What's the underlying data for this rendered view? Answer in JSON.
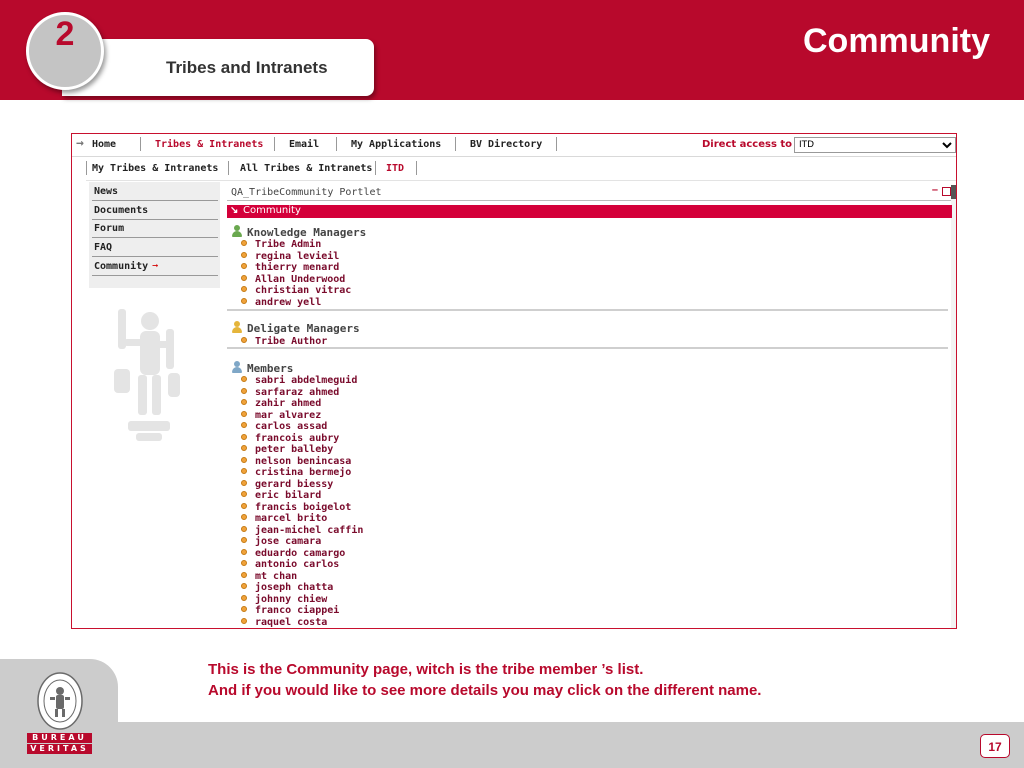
{
  "slide": {
    "title": "Community",
    "section_number": "2",
    "section_label": "Tribes and Intranets",
    "caption_line1": "This is the Community page, witch is the tribe member ’s list.",
    "caption_line2": "And if you would like to see more details you may click on the different name.",
    "page_number": "17",
    "logo": {
      "line1": "BUREAU",
      "line2": "VERITAS",
      "seal_text": "BUREAU VERITAS 1828"
    }
  },
  "colors": {
    "brand": "#b8092c",
    "accent_bar": "#d4003a",
    "footer_gray": "#cccccc"
  },
  "topnav": {
    "items": [
      "Home",
      "Tribes & Intranets",
      "Email",
      "My Applications",
      "BV Directory"
    ],
    "active": "Tribes & Intranets",
    "direct_access_label": "Direct access to :",
    "direct_access_value": "ITD"
  },
  "subnav": {
    "items": [
      "My Tribes & Intranets",
      "All Tribes & Intranets",
      "ITD"
    ],
    "active": "ITD"
  },
  "leftnav": {
    "items": [
      "News",
      "Documents",
      "Forum",
      "FAQ",
      "Community"
    ],
    "current": "Community",
    "current_icon": "right-arrow-icon"
  },
  "portlet": {
    "title": "QA_TribeCommunity Portlet",
    "header": "Community",
    "sections": [
      {
        "title": "Knowledge Managers",
        "icon": "green-person-icon",
        "people": [
          "Tribe Admin",
          "regina levieil",
          "thierry menard",
          "Allan Underwood",
          "christian vitrac",
          "andrew yell"
        ]
      },
      {
        "title": "Deligate Managers",
        "icon": "yellow-person-icon",
        "people": [
          "Tribe Author"
        ]
      },
      {
        "title": "Members",
        "icon": "blue-person-icon",
        "people": [
          "sabri abdelmeguid",
          "sarfaraz ahmed",
          "zahir ahmed",
          "mar alvarez",
          "carlos assad",
          "francois aubry",
          "peter balleby",
          "nelson benincasa",
          "cristina bermejo",
          "gerard biessy",
          "eric bilard",
          "francis boigelot",
          "marcel brito",
          "jean-michel caffin",
          "jose camara",
          "eduardo camargo",
          "antonio carlos",
          "mt chan",
          "joseph chatta",
          "johnny chiew",
          "franco ciappei",
          "raquel costa"
        ]
      }
    ]
  }
}
